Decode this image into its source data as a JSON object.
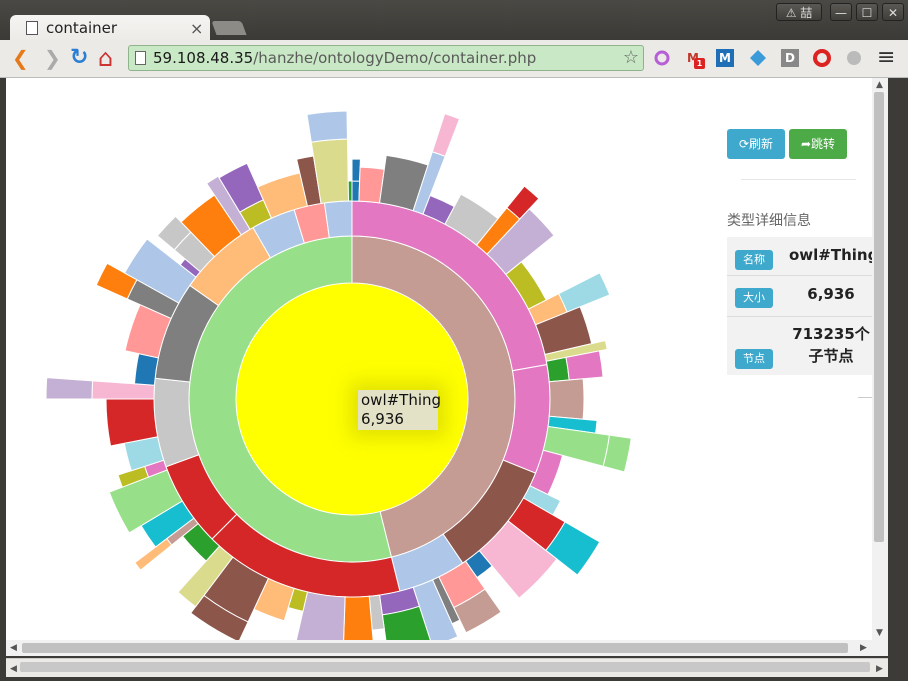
{
  "browser": {
    "tab_title": "container",
    "tab_close": "×",
    "url_host": "59.108.48.35",
    "url_path": "/hanzhe/ontologyDemo/container.php",
    "ime_indicator": "⚠ 喆",
    "back_glyph": "❮",
    "forward_glyph": "❯",
    "reload_glyph": "↻",
    "home_glyph": "⌂",
    "star_glyph": "☆",
    "menu_glyph": "≡",
    "extensions": [
      "circle-ext-icon",
      "gmail-ext-icon",
      "m-ext-icon",
      "diamond-ext-icon",
      "d-ext-icon",
      "opera-ext-icon",
      "m-circle-ext-icon"
    ],
    "gmail_badge": "1"
  },
  "panel": {
    "refresh_label": "刷新",
    "jump_label": "跳转",
    "section_title": "类型详细信息",
    "rows": [
      {
        "label": "名称",
        "value": "owl#Thing"
      },
      {
        "label": "大小",
        "value": "6,936"
      },
      {
        "label": "节点",
        "value": "713235个子节点"
      }
    ]
  },
  "tooltip": {
    "name": "owl#Thing",
    "value": "6,936"
  },
  "colors": {
    "center": "#ffff00",
    "refresh": "#3ea9cc",
    "jump": "#4caa47",
    "badge": "#3ea9cc"
  }
}
